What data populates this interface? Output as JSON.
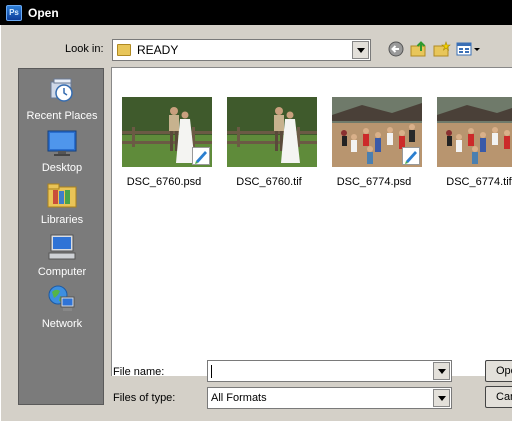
{
  "window": {
    "title": "Open",
    "app_icon": "ps-icon",
    "app_icon_text": "Ps"
  },
  "lookin": {
    "label": "Look in:",
    "value": "READY"
  },
  "toolbar_icons": [
    "back-arrow-icon",
    "up-folder-icon",
    "new-folder-icon",
    "view-menu-icon"
  ],
  "places": [
    {
      "label": "Recent Places",
      "icon": "recent-places-icon"
    },
    {
      "label": "Desktop",
      "icon": "desktop-icon"
    },
    {
      "label": "Libraries",
      "icon": "libraries-icon"
    },
    {
      "label": "Computer",
      "icon": "computer-icon"
    },
    {
      "label": "Network",
      "icon": "network-icon"
    }
  ],
  "files": [
    {
      "name": "DSC_6760.psd",
      "scene": "couple",
      "badge": true
    },
    {
      "name": "DSC_6760.tif",
      "scene": "couple",
      "badge": false
    },
    {
      "name": "DSC_6774.psd",
      "scene": "crowd",
      "badge": true
    },
    {
      "name": "DSC_6774.tif",
      "scene": "crowd",
      "badge": false
    }
  ],
  "filename": {
    "label": "File name:",
    "value": ""
  },
  "filetype": {
    "label": "Files of type:",
    "value": "All Formats"
  },
  "buttons": {
    "open": "Open",
    "cancel": "Cancel"
  }
}
